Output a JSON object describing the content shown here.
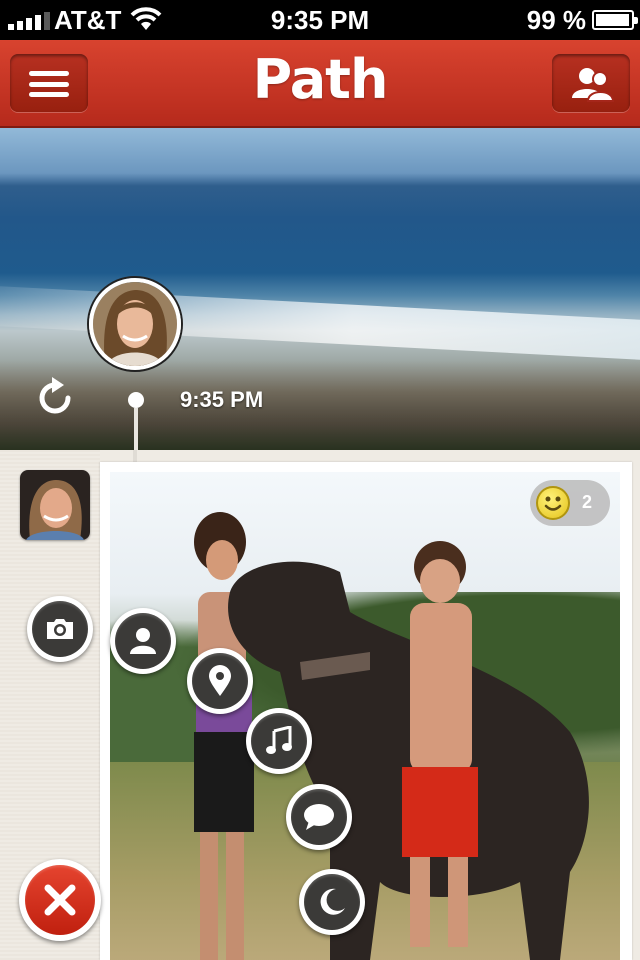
{
  "status_bar": {
    "carrier": "AT&T",
    "time": "9:35 PM",
    "battery": "99 %",
    "battery_level": 0.99
  },
  "nav": {
    "logo": "Path"
  },
  "cover": {
    "time": "9:35 PM"
  },
  "post": {
    "emotion_count": "2"
  },
  "colors": {
    "nav_red": "#c9351f",
    "close_red": "#d8321f",
    "button_dark": "#3b3a38",
    "feed_bg": "#efebe4"
  },
  "icons": [
    "menu-icon",
    "friends-icon",
    "refresh-icon",
    "camera-icon",
    "person-icon",
    "location-pin-icon",
    "music-note-icon",
    "speech-bubble-icon",
    "moon-icon",
    "close-icon",
    "smiley-icon"
  ]
}
